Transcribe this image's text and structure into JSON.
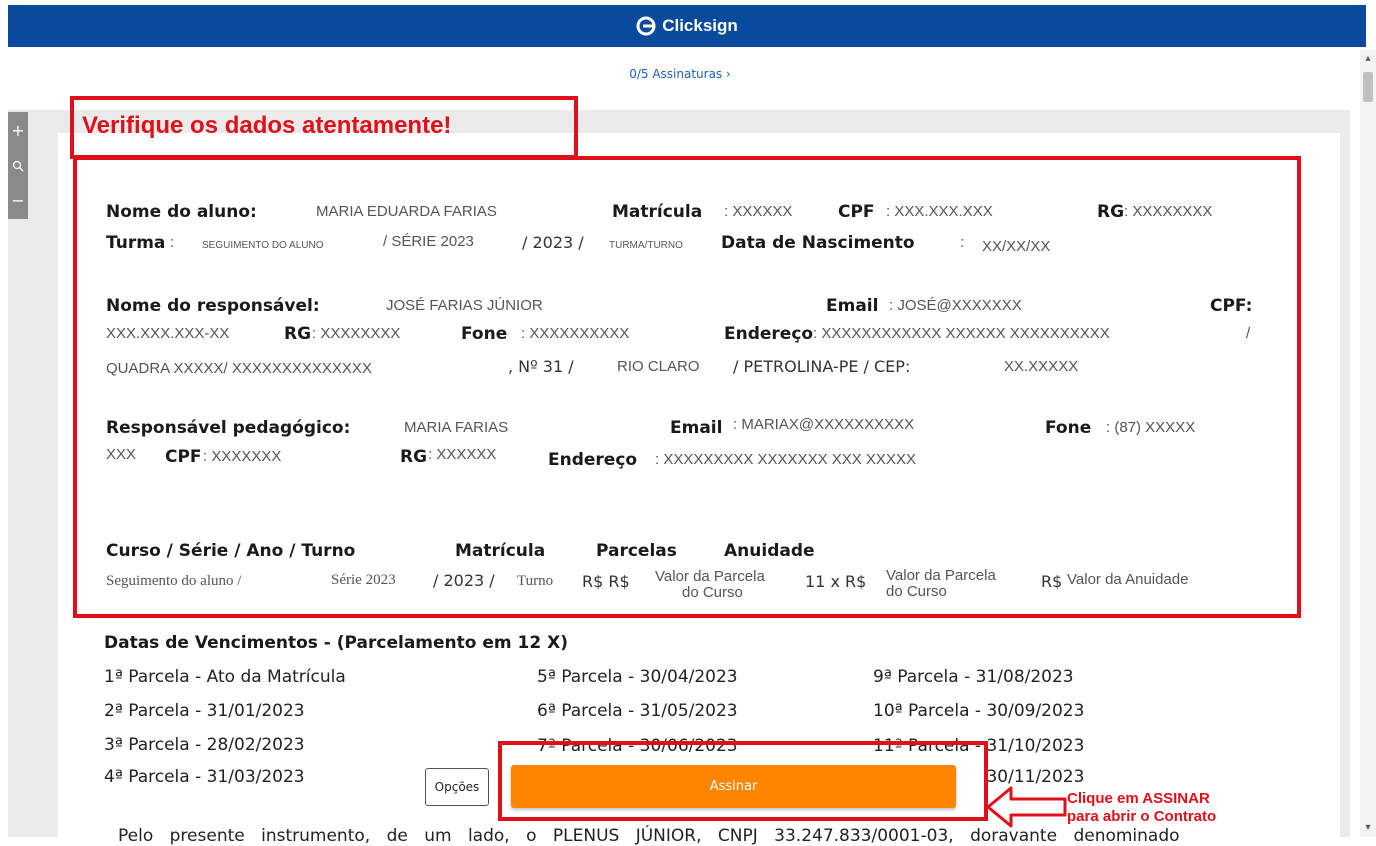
{
  "header": {
    "brand": "Clicksign",
    "signatures_link": "0/5 Assinaturas"
  },
  "zoom": {
    "plus": "+",
    "minus": "−"
  },
  "verify_title": "Verifique os dados atentamente!",
  "aluno": {
    "nome_label": "Nome do aluno:",
    "nome_value": "MARIA EDUARDA FARIAS",
    "matricula_label": "Matrícula",
    "matricula_value": ": XXXXXX",
    "cpf_label": "CPF",
    "cpf_value": ": XXX.XXX.XXX",
    "rg_label": "RG",
    "rg_value": ": XXXXXXXX",
    "turma_label": "Turma",
    "turma_colon": ":",
    "turma_seg": "SEGUIMENTO DO ALUNO",
    "turma_serie": "/ SÉRIE 2023",
    "turma_ano": "/ 2023 /",
    "turma_turno": "TURMA/TURNO",
    "nasc_label": "Data de Nascimento",
    "nasc_colon": ":",
    "nasc_value": "XX/XX/XX"
  },
  "responsavel": {
    "nome_label": "Nome do responsável:",
    "nome_value": "JOSÉ FARIAS JÚNIOR",
    "email_label": "Email",
    "email_value": ": JOSÉ@XXXXXXX",
    "cpf_label": "CPF:",
    "cpf_value": "XXX.XXX.XXX-XX",
    "rg_label": "RG",
    "rg_value": ": XXXXXXXX",
    "fone_label": "Fone",
    "fone_value": ": XXXXXXXXXX",
    "endereco_label": "Endereço",
    "endereco_value": ": XXXXXXXXXXXX XXXXXX XXXXXXXXXX",
    "endereco_slash": "/",
    "quadra": "QUADRA XXXXX/ XXXXXXXXXXXXXX",
    "numero": ", Nº 31 /",
    "bairro": "RIO CLARO",
    "cidade": "/ PETROLINA-PE / CEP:",
    "cep": "XX.XXXXX"
  },
  "pedagogico": {
    "nome_label": "Responsável pedagógico:",
    "nome_value": "MARIA FARIAS",
    "email_label": "Email",
    "email_value": ": MARIAX@XXXXXXXXXX",
    "fone_label": "Fone",
    "fone_value": ": (87) XXXXX",
    "fone_cont": "XXX",
    "cpf_label": "CPF",
    "cpf_value": ": XXXXXXX",
    "rg_label": "RG",
    "rg_value": ": XXXXXX",
    "endereco_label": "Endereço",
    "endereco_value": ": XXXXXXXXX XXXXXXX XXX XXXXX"
  },
  "curso": {
    "headers": [
      "Curso / Série / Ano / Turno",
      "Matrícula",
      "Parcelas",
      "Anuidade"
    ],
    "seg": "Seguimento do aluno /",
    "serie": "Série 2023",
    "ano": "/ 2023 /",
    "turno": "Turno",
    "rs1": "R$ R$",
    "parcela1_a": "Valor da Parcela",
    "parcela1_b": "do Curso",
    "parcelas_qtd": "11 x R$",
    "parcela2_a": "Valor da Parcela",
    "parcela2_b": "do Curso",
    "rs2": "R$",
    "anuidade": "Valor da Anuidade"
  },
  "vencimentos": {
    "title": "Datas de Vencimentos - (Parcelamento em 12 X)",
    "col1": [
      "1ª Parcela - Ato da Matrícula",
      "2ª Parcela - 31/01/2023",
      "3ª Parcela - 28/02/2023",
      "4ª Parcela - 31/03/2023"
    ],
    "col2": [
      "5ª Parcela - 30/04/2023",
      "6ª Parcela - 31/05/2023",
      "7ª Parcela - 30/06/2023"
    ],
    "col3": [
      "9ª Parcela - 31/08/2023",
      "10ª Parcela - 30/09/2023",
      "11ª Parcela - 31/10/2023",
      "12ª Parcela - 30/11/2023"
    ]
  },
  "bottom_text": "Pelo presente instrumento, de um lado, o PLENUS JÚNIOR, CNPJ 33.247.833/0001-03, doravante denominado",
  "actions": {
    "opcoes": "Opções",
    "assinar": "Assinar"
  },
  "annotation": {
    "line1": "Clique em ASSINAR",
    "line2": "para abrir o Contrato"
  },
  "colors": {
    "brand_blue": "#0a4a9c",
    "assinar_orange": "#ff8400",
    "highlight_red": "#e0101b"
  }
}
